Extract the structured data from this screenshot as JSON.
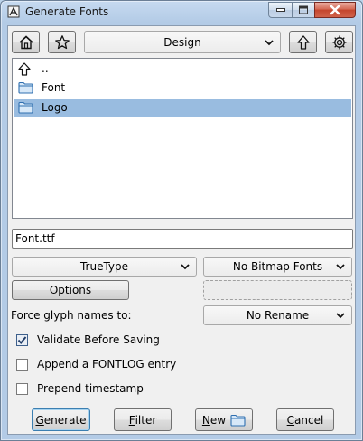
{
  "window": {
    "title": "Generate Fonts",
    "close_color": "#c4452d",
    "selection_color": "#99bce0"
  },
  "toolbar": {
    "home_icon": "home-icon",
    "bookmark_icon": "star-icon",
    "directory": "Design",
    "up_icon": "arrow-up-icon",
    "settings_icon": "gear-icon"
  },
  "file_list": {
    "items": [
      {
        "label": "..",
        "icon": "parent-directory-icon",
        "selected": false
      },
      {
        "label": "Font",
        "icon": "folder-icon",
        "selected": false
      },
      {
        "label": "Logo",
        "icon": "folder-icon",
        "selected": true
      }
    ]
  },
  "filename": {
    "value": "Font.ttf"
  },
  "format_select": {
    "value": "TrueType"
  },
  "bitmap_select": {
    "value": "No Bitmap Fonts"
  },
  "options_button": {
    "label": "Options"
  },
  "force_glyph": {
    "label": "Force glyph names to:",
    "value": "No Rename"
  },
  "checkboxes": [
    {
      "label": "Validate Before Saving",
      "checked": true
    },
    {
      "label": "Append a FONTLOG entry",
      "checked": false
    },
    {
      "label": "Prepend timestamp",
      "checked": false
    }
  ],
  "buttons": {
    "generate": {
      "mnemonic": "G",
      "rest": "enerate"
    },
    "filter": {
      "mnemonic": "F",
      "rest": "ilter"
    },
    "new": {
      "mnemonic": "N",
      "rest": "ew"
    },
    "cancel": {
      "mnemonic": "C",
      "rest": "ancel"
    }
  }
}
